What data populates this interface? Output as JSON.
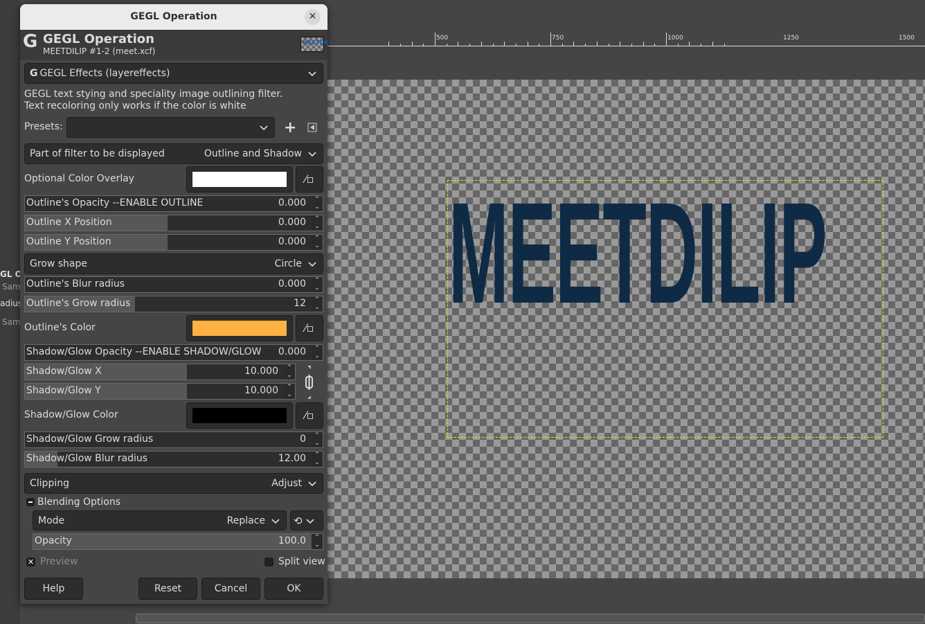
{
  "left_panel_fragments": [
    "GL Op",
    "Sam",
    "adius",
    "Sam"
  ],
  "ruler": {
    "labels": [
      "500",
      "750",
      "1000",
      "1250",
      "1500"
    ]
  },
  "canvas": {
    "layer_text": "MEETDILIP",
    "text_color": "#0f2a45"
  },
  "dialog": {
    "window_title": "GEGL Operation",
    "header_title": "GEGL Operation",
    "header_subtitle": "MEETDILIP #1-2 (meet.xcf)",
    "operation": "GEGL Effects (layereffects)",
    "description_line1": "GEGL text stying and speciality image outlining filter.",
    "description_line2": "Text recoloring only works if the color is white",
    "presets_label": "Presets:",
    "presets_value": "",
    "part_of_filter": {
      "label": "Part of filter to be displayed",
      "value": "Outline and Shadow"
    },
    "color_overlay": {
      "label": "Optional Color Overlay",
      "color": "#ffffff"
    },
    "outline_opacity": {
      "label": "Outline's Opacity --ENABLE OUTLINE",
      "value": "0.000",
      "fill": 0
    },
    "outline_x": {
      "label": "Outline X Position",
      "value": "0.000",
      "fill": 0.48
    },
    "outline_y": {
      "label": "Outline Y Position",
      "value": "0.000",
      "fill": 0.48
    },
    "grow_shape": {
      "label": "Grow shape",
      "value": "Circle"
    },
    "outline_blur": {
      "label": "Outline's Blur radius",
      "value": "0.000",
      "fill": 0
    },
    "outline_grow": {
      "label": "Outline's Grow radius",
      "value": "12",
      "fill": 0.37
    },
    "outline_color": {
      "label": "Outline's Color",
      "color": "#ffb142"
    },
    "shadow_opacity": {
      "label": "Shadow/Glow Opacity --ENABLE SHADOW/GLOW",
      "value": "0.000",
      "fill": 0
    },
    "shadow_x": {
      "label": "Shadow/Glow X",
      "value": "10.000",
      "fill": 0.6
    },
    "shadow_y": {
      "label": "Shadow/Glow Y",
      "value": "10.000",
      "fill": 0.6
    },
    "shadow_color": {
      "label": "Shadow/Glow Color",
      "color": "#000000"
    },
    "shadow_grow": {
      "label": "Shadow/Glow Grow radius",
      "value": "0",
      "fill": 0
    },
    "shadow_blur": {
      "label": "Shadow/Glow Blur radius",
      "value": "12.00",
      "fill": 0.11
    },
    "clipping": {
      "label": "Clipping",
      "value": "Adjust"
    },
    "blending": {
      "label": "Blending Options",
      "mode_label": "Mode",
      "mode_value": "Replace",
      "opacity_label": "Opacity",
      "opacity_value": "100.0",
      "opacity_fill": 1
    },
    "preview": {
      "label": "Preview",
      "checked": true
    },
    "split_view": {
      "label": "Split view",
      "checked": false
    },
    "buttons": {
      "help": "Help",
      "reset": "Reset",
      "cancel": "Cancel",
      "ok": "OK"
    }
  }
}
